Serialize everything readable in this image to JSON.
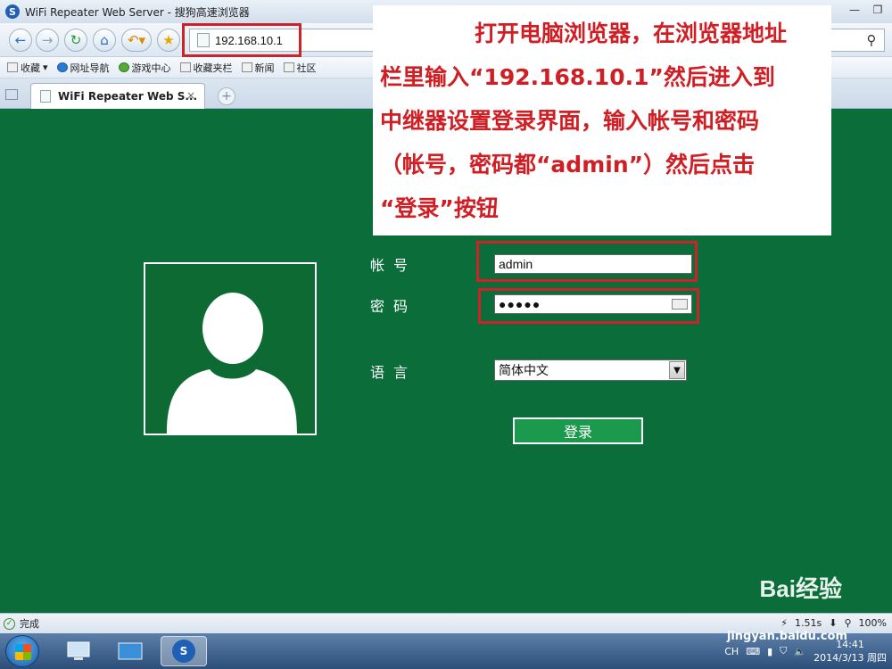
{
  "window": {
    "title": "WiFi Repeater Web Server - 搜狗高速浏览器"
  },
  "address": {
    "url": "192.168.10.1"
  },
  "bookmarks": [
    {
      "label": "收藏"
    },
    {
      "label": "网址导航"
    },
    {
      "label": "游戏中心"
    },
    {
      "label": "收藏夹栏"
    },
    {
      "label": "新闻"
    },
    {
      "label": "社区"
    }
  ],
  "tab": {
    "title": "WiFi Repeater Web S...",
    "close": "×"
  },
  "login": {
    "account_label": "帐号",
    "password_label": "密码",
    "language_label": "语言",
    "account_value": "admin",
    "password_value": "●●●●●",
    "language_value": "简体中文",
    "login_button": "登录"
  },
  "annotation": {
    "line1": "打开电脑浏览器，在浏览器地址",
    "line2": "栏里输入“192.168.10.1”然后进入到",
    "line3": "中继器设置登录界面，输入帐号和密码",
    "line4": "（帐号，密码都“admin”）然后点击",
    "line5": "“登录”按钮"
  },
  "status": {
    "text": "完成",
    "time": "1.51s",
    "zoom": "100%"
  },
  "taskbar": {
    "input_lang": "CH",
    "clock_time": "14:41",
    "clock_date": "2014/3/13 周四"
  },
  "watermark": {
    "brand": "Bai经验",
    "url": "jingyan.baidu.com"
  },
  "colors": {
    "content_bg": "#0b6e3a",
    "annotation_red": "#d01f24",
    "highlight_red": "#cc2228",
    "button_green": "#1b9a4e"
  }
}
